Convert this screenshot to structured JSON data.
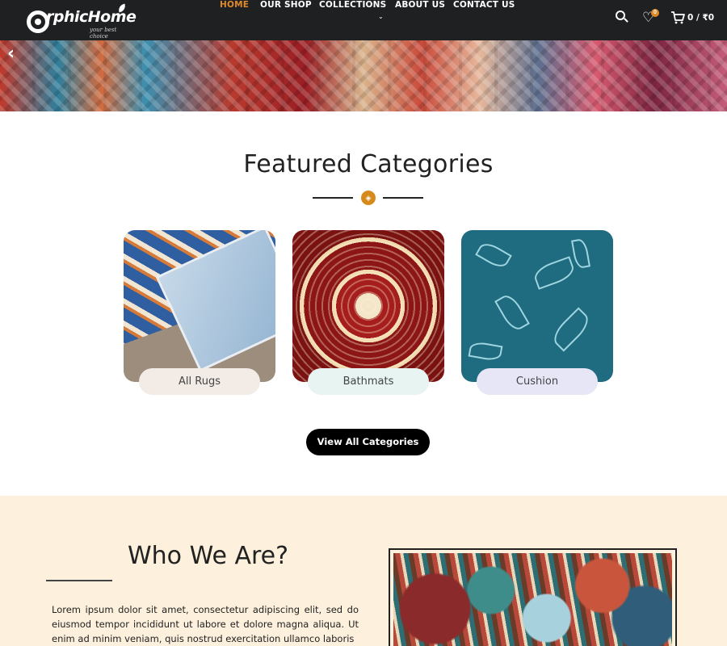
{
  "header": {
    "logo_text": "rphicHome",
    "logo_tagline": "your best choice",
    "nav": [
      {
        "label": "HOME",
        "active": true
      },
      {
        "label": "OUR SHOP",
        "active": false
      },
      {
        "label": "COLLECTIONS",
        "active": false,
        "has_dropdown": true
      },
      {
        "label": "ABOUT US",
        "active": false
      },
      {
        "label": "CONTACT US",
        "active": false
      }
    ],
    "wishlist_count": "0",
    "cart_total": "0 / ₹0",
    "icons": [
      "search-icon",
      "heart-icon",
      "cart-icon"
    ],
    "accent_color": "#e0892a"
  },
  "hero": {
    "prev_arrow": "‹"
  },
  "featured": {
    "title": "Featured Categories",
    "categories": [
      {
        "label": "All Rugs"
      },
      {
        "label": "Bathmats"
      },
      {
        "label": "Cushion"
      }
    ],
    "view_all_label": "View All Categories"
  },
  "who": {
    "title": "Who We Are?",
    "text": "Lorem ipsum dolor sit amet, consectetur adipiscing elit, sed do eiusmod tempor incididunt ut labore et dolore magna aliqua. Ut enim ad minim veniam, quis nostrud exercitation ullamco laboris"
  }
}
